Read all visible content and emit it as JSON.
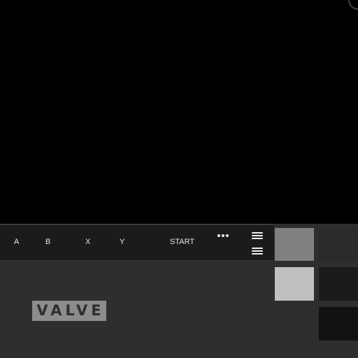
{
  "buttons": {
    "a": "A",
    "b": "B",
    "x": "X",
    "y": "Y",
    "start": "START"
  },
  "icons": {
    "more": "more-dots-icon",
    "menu_top": "hamburger-menu-icon",
    "menu_bottom": "hamburger-menu-icon"
  },
  "logo": {
    "text": "VALVE"
  },
  "swatches": [
    {
      "color": "#808080"
    },
    {
      "color": "#2a2a2a"
    },
    {
      "color": "#c0c0c0"
    },
    {
      "color": "#1a1a1a"
    },
    {
      "color": "#111111"
    }
  ],
  "colors": {
    "screen": "#000000",
    "bar": "#1b1b1b",
    "body": "#2e2e2e",
    "logo_bg": "#8c8c8c"
  }
}
